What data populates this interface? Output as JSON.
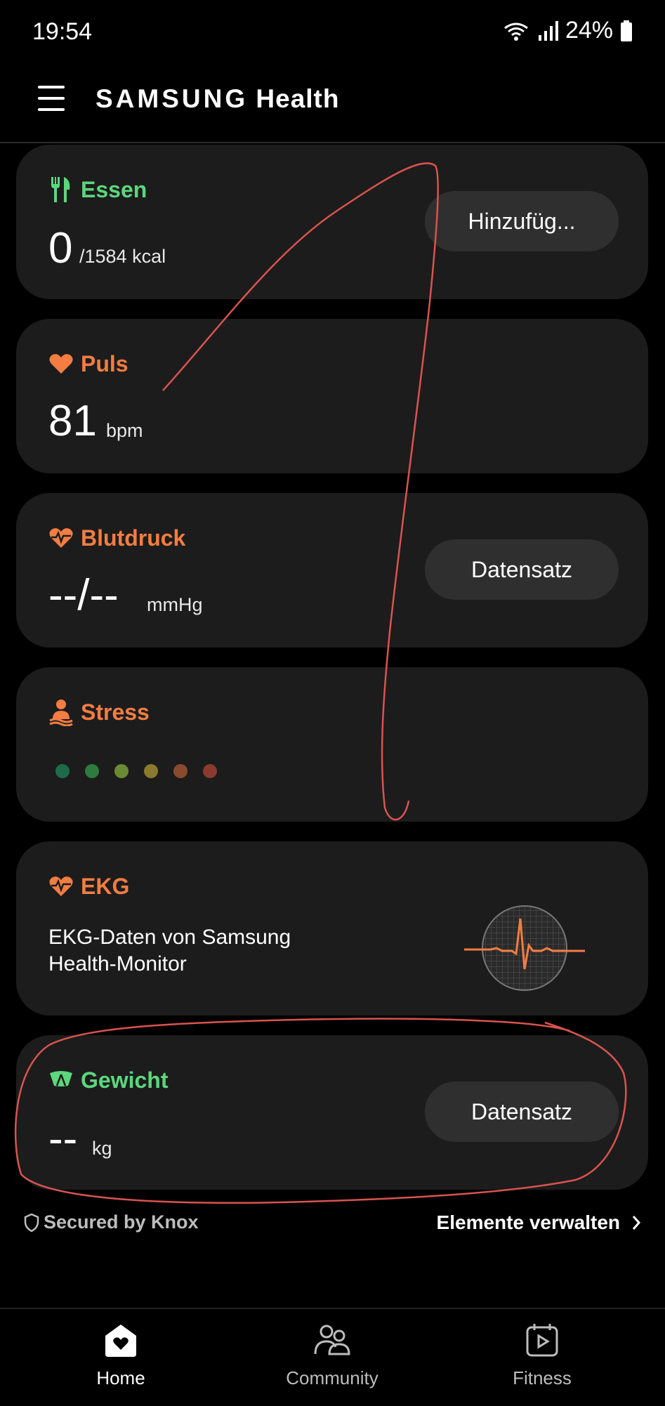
{
  "status": {
    "time": "19:54",
    "battery": "24%"
  },
  "app": {
    "brand_part1": "SAMSUNG",
    "brand_part2": "Health"
  },
  "cards": {
    "essen": {
      "title": "Essen",
      "value": "0",
      "unit": "/1584 kcal",
      "button": "Hinzufüg..."
    },
    "puls": {
      "title": "Puls",
      "value": "81",
      "unit": "bpm"
    },
    "blutdruck": {
      "title": "Blutdruck",
      "value": "--/--",
      "unit": "mmHg",
      "button": "Datensatz"
    },
    "stress": {
      "title": "Stress",
      "dot_colors": [
        "#1e6b4a",
        "#2f7a3e",
        "#6a8a34",
        "#8a7a2e",
        "#8a4a2e",
        "#8a3a2e"
      ]
    },
    "ekg": {
      "title": "EKG",
      "description": "EKG-Daten von Samsung Health-Monitor"
    },
    "gewicht": {
      "title": "Gewicht",
      "value": "--",
      "unit": "kg",
      "button": "Datensatz"
    }
  },
  "footer": {
    "knox": "Secured by Knox",
    "manage": "Elemente verwalten"
  },
  "nav": {
    "home": "Home",
    "community": "Community",
    "fitness": "Fitness"
  },
  "colors": {
    "green": "#5bd77c",
    "orange": "#f47d42",
    "annotation": "#d9534f"
  }
}
